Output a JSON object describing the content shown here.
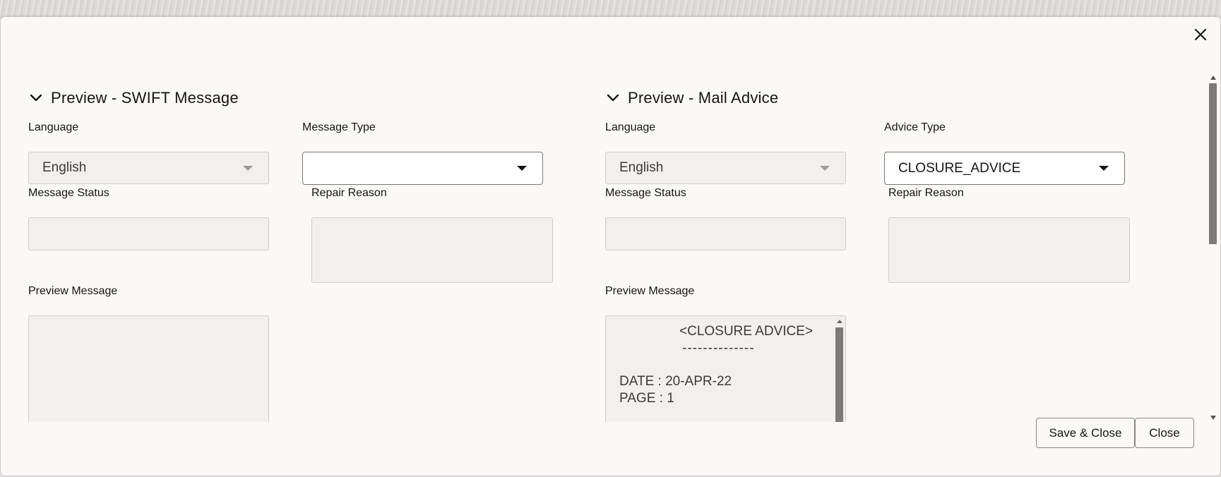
{
  "dialog": {
    "close_icon": "close-icon"
  },
  "swift": {
    "title": "Preview - SWIFT Message",
    "language_label": "Language",
    "language_value": "English",
    "message_type_label": "Message Type",
    "message_type_value": "",
    "message_status_label": "Message Status",
    "message_status_value": "",
    "repair_reason_label": "Repair Reason",
    "repair_reason_value": "",
    "preview_label": "Preview Message",
    "preview_value": ""
  },
  "mail": {
    "title": "Preview - Mail Advice",
    "language_label": "Language",
    "language_value": "English",
    "advice_type_label": "Advice Type",
    "advice_type_value": "CLOSURE_ADVICE",
    "message_status_label": "Message Status",
    "message_status_value": "",
    "repair_reason_label": "Repair Reason",
    "repair_reason_value": "",
    "preview_label": "Preview Message",
    "preview_lines": {
      "line1": "<CLOSURE ADVICE>",
      "line2": "--------------",
      "line3": "DATE : 20-APR-22",
      "line4": "PAGE : 1"
    }
  },
  "footer": {
    "save_close_label": "Save & Close",
    "close_label": "Close"
  },
  "colors": {
    "dialog_bg": "#fbf9f8",
    "field_bg": "#f1f0ef",
    "text": "#161513",
    "scroll_thumb": "#7d7b78"
  }
}
